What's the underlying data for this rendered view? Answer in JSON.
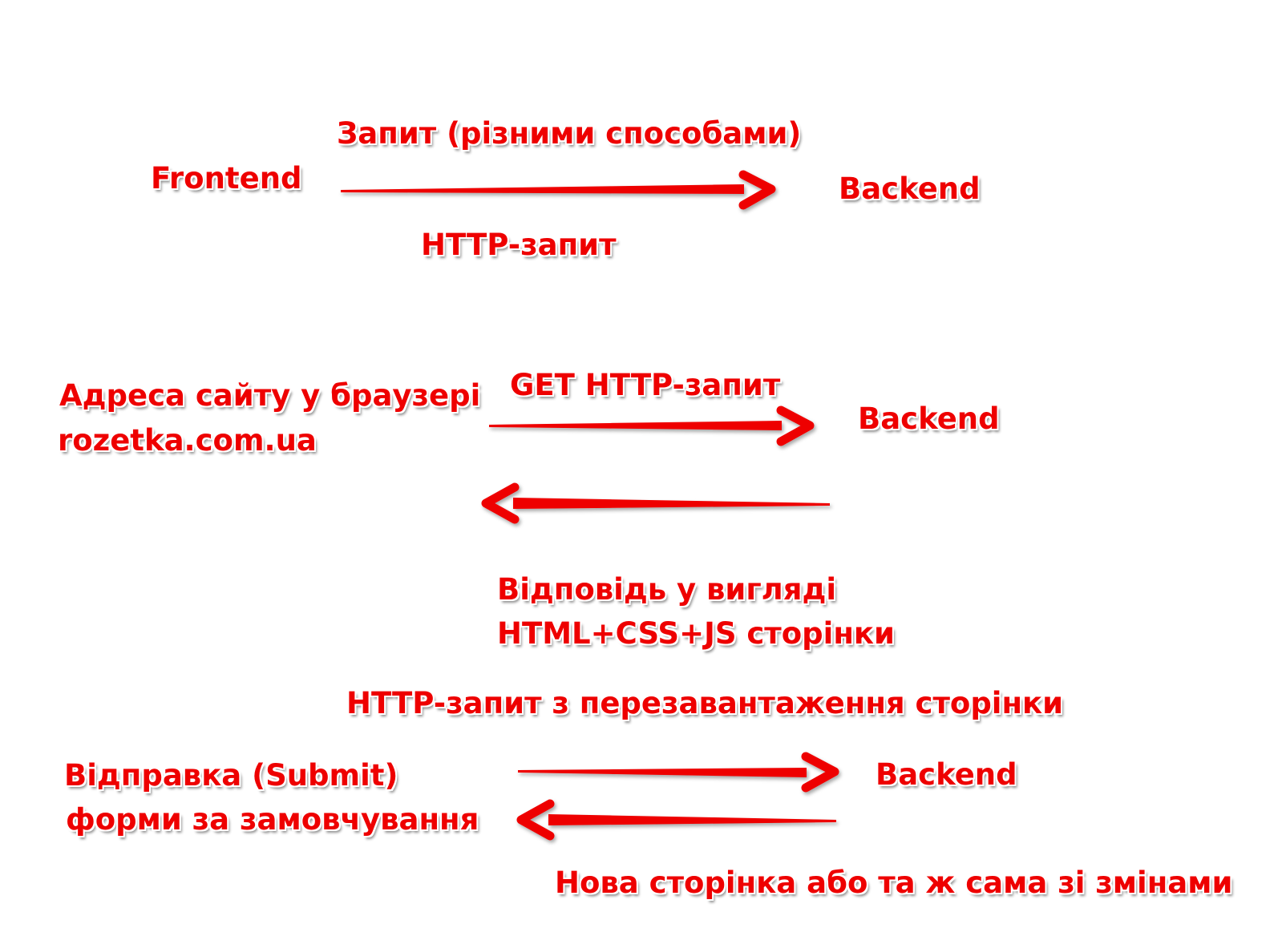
{
  "colors": {
    "accent": "#ee0000",
    "outline": "#ffffff"
  },
  "section1": {
    "request_ways": "Запит (різними способами)",
    "frontend": "Frontend",
    "backend": "Backend",
    "http_request": "HTTP-запит"
  },
  "section2": {
    "site_address_line1": "Адреса сайту у браузері",
    "site_address_line2": "rozetka.com.ua",
    "get_request": "GET HTTP-запит",
    "backend": "Backend",
    "response_line1": "Відповідь у вигляді",
    "response_line2": "HTML+CSS+JS сторінки"
  },
  "section3": {
    "reload_request": "HTTP-запит з перезавантаження сторінки",
    "submit_line1": "Відправка (Submit)",
    "submit_line2": "форми за замовчування",
    "backend": "Backend",
    "new_page": "Нова сторінка або та ж сама зі змінами"
  }
}
